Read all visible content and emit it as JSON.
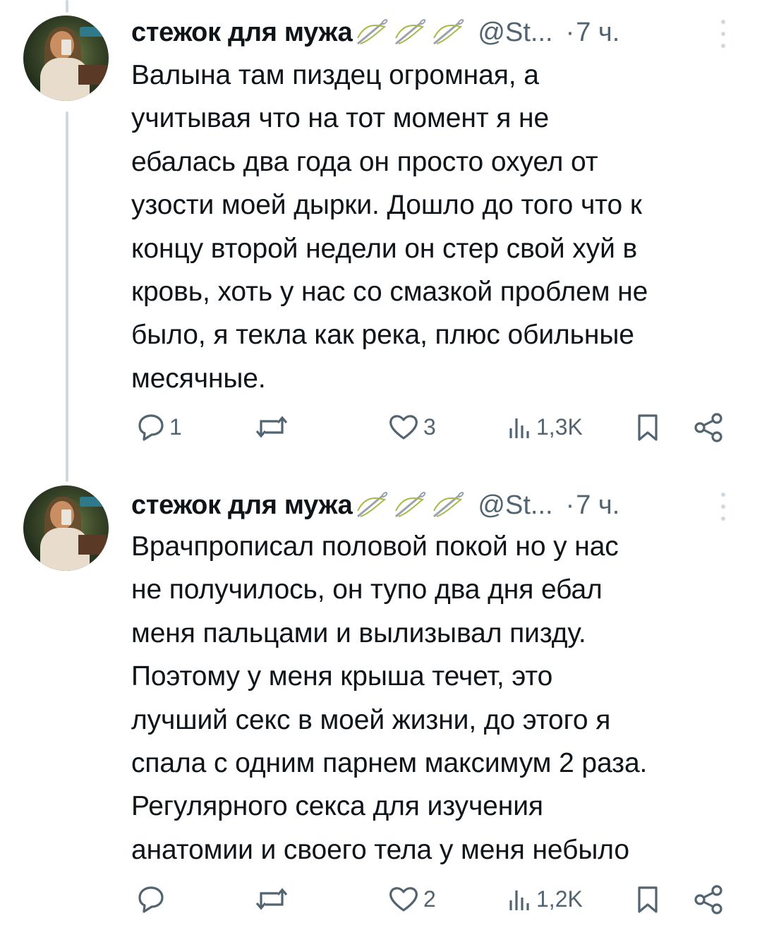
{
  "tweets": [
    {
      "author_name": "стежок для мужа",
      "name_emoji": [
        "needle-emoji",
        "needle-emoji",
        "needle-emoji"
      ],
      "handle": "@St...",
      "time_sep": "·",
      "time": "7 ч.",
      "text": "Валына там пиздец огромная, а\nучитывая что на тот момент я не\nебалась два года он просто охуел от\nузости моей дырки. Дошло до того что к\nконцу второй недели он стер свой хуй в\nкровь, хоть у нас со смазкой проблем не\nбыло, я текла как река, плюс обильные\nмесячные.",
      "actions": {
        "replies": "1",
        "retweets": "",
        "likes": "3",
        "views": "1,3K"
      }
    },
    {
      "author_name": "стежок для мужа",
      "name_emoji": [
        "needle-emoji",
        "needle-emoji",
        "needle-emoji"
      ],
      "handle": "@St...",
      "time_sep": "·",
      "time": "7 ч.",
      "text": "Врачпрописал половой покой но у нас\nне получилось, он тупо два дня ебал\nменя пальцами и вылизывал пизду.\nПоэтому у меня крыша течет, это\nлучший секс в моей жизни, до этого я\nспала с одним парнем максимум 2 раза.\nРегулярного секса для изучения\nанатомии и своего тела у меня небыло",
      "actions": {
        "replies": "",
        "retweets": "",
        "likes": "2",
        "views": "1,2K"
      }
    }
  ],
  "colors": {
    "text": "#0f1419",
    "muted": "#536471",
    "thread_line": "#cfd9de",
    "background": "#ffffff"
  }
}
